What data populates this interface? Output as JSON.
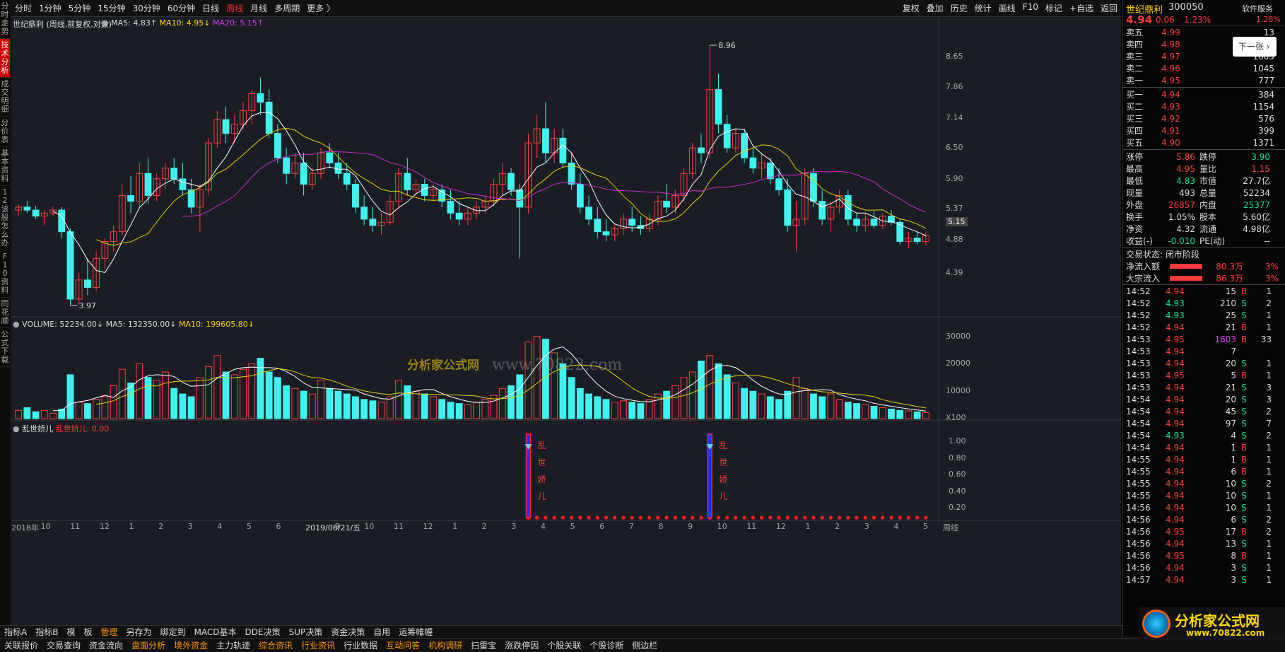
{
  "vtabs": [
    "分时走势",
    "技术分析",
    "成交明细",
    "分价表",
    "基本资料",
    "12该股怎么办",
    "F10资料",
    "同花顺",
    "公式下载"
  ],
  "topbar": {
    "periods": [
      "分时",
      "1分钟",
      "5分钟",
      "15分钟",
      "30分钟",
      "60分钟",
      "日线",
      "周线",
      "月线",
      "多周期",
      "更多 〉"
    ],
    "active": "周线",
    "right": [
      "复权",
      "叠加",
      "历史",
      "统计",
      "画线",
      "F10",
      "标记",
      "+自选",
      "返回"
    ]
  },
  "legend": {
    "title": "世纪鼎利 (周线,前复权,对数)",
    "ma5": "MA5: 4.83↑",
    "ma10": "MA10: 4.95↓",
    "ma20": "MA20: 5.15↑"
  },
  "volume_legend": {
    "vol": "VOLUME: 52234.00↓",
    "ma5": "MA5: 132350.00↓",
    "ma10": "MA10: 199605.80↓"
  },
  "indicator_legend": {
    "name": "乱世娇儿",
    "value": "乱世娇儿: 0.00",
    "signal_text": [
      "乱",
      "世",
      "娇",
      "儿"
    ]
  },
  "price_axis": [
    "8.65",
    "7.86",
    "7.14",
    "6.50",
    "5.90",
    "5.37",
    "5.15",
    "4.88",
    "4.39"
  ],
  "price_marks": {
    "high": "8.96",
    "low": "3.97"
  },
  "volume_axis": [
    "30000",
    "20000",
    "10000",
    "X100"
  ],
  "ind_axis": [
    "1.00",
    "0.80",
    "0.60",
    "0.40",
    "0.20"
  ],
  "time_axis": [
    "2018年",
    "10",
    "11",
    "12",
    "1",
    "2",
    "3",
    "4",
    "5",
    "6",
    "2019/06/21/五",
    "9",
    "10",
    "11",
    "12",
    "1",
    "2",
    "3",
    "4",
    "5",
    "6",
    "7",
    "8",
    "9",
    "10",
    "11",
    "12",
    "1",
    "2",
    "3",
    "4",
    "5",
    "周线"
  ],
  "watermark": {
    "site": "分析家公式网",
    "url": "www.70822.com"
  },
  "bottom_tabs": [
    "指标A",
    "指标B",
    "模",
    "板",
    "管理",
    "另存为",
    "绑定到",
    "MACD基本",
    "DDE决策",
    "SUP决策",
    "资金决策",
    "自用",
    "运筹帷幄"
  ],
  "status_bar": [
    "关联报价",
    "交易查询",
    "资金流向",
    "盘面分析",
    "境外资金",
    "主力轨迹",
    "综合资讯",
    "行业资讯",
    "行业数据",
    "互动问答",
    "机构调研",
    "扫雷宝",
    "涨跌停因",
    "个股关联",
    "个股诊断",
    "侧边栏"
  ],
  "quote": {
    "name": "世纪鼎利",
    "code": "300050",
    "service": "软件服务",
    "price": "4.94",
    "change": "0.06",
    "pct": "1.23%",
    "pct2": "1.28%",
    "next_btn": "下一张",
    "asks": [
      [
        "卖五",
        "4.99",
        "13"
      ],
      [
        "卖四",
        "4.98",
        "13"
      ],
      [
        "卖三",
        "4.97",
        "1005"
      ],
      [
        "卖二",
        "4.96",
        "1045"
      ],
      [
        "卖一",
        "4.95",
        "777"
      ]
    ],
    "bids": [
      [
        "买一",
        "4.94",
        "384"
      ],
      [
        "买二",
        "4.93",
        "1154"
      ],
      [
        "买三",
        "4.92",
        "576"
      ],
      [
        "买四",
        "4.91",
        "399"
      ],
      [
        "买五",
        "4.90",
        "1371"
      ]
    ],
    "stats": [
      [
        "涨停",
        "5.86",
        "跌停",
        "3.90"
      ],
      [
        "最高",
        "4.95",
        "量比",
        "1.15"
      ],
      [
        "最低",
        "4.83",
        "市值",
        "27.7亿"
      ],
      [
        "现量",
        "493",
        "总量",
        "52234"
      ],
      [
        "外盘",
        "26857",
        "内盘",
        "25377"
      ],
      [
        "换手",
        "1.05%",
        "股本",
        "5.60亿"
      ],
      [
        "净资",
        "4.32",
        "流通",
        "4.98亿"
      ],
      [
        "收益(-)",
        "-0.010",
        "PE(动)",
        "--"
      ]
    ],
    "status": "交易状态: 闭市阶段",
    "flows": [
      [
        "净流入额",
        "80.3万",
        "3%"
      ],
      [
        "大宗流入",
        "86.3万",
        "3%"
      ]
    ],
    "ticks": [
      [
        "14:52",
        "4.94",
        "15",
        "B",
        "1"
      ],
      [
        "14:52",
        "4.93",
        "210",
        "S",
        "2"
      ],
      [
        "14:52",
        "4.93",
        "25",
        "S",
        "1"
      ],
      [
        "14:52",
        "4.94",
        "21",
        "B",
        "1"
      ],
      [
        "14:53",
        "4.95",
        "1603",
        "B",
        "33"
      ],
      [
        "14:53",
        "4.94",
        "7",
        "",
        ""
      ],
      [
        "14:53",
        "4.94",
        "20",
        "S",
        "1"
      ],
      [
        "14:53",
        "4.95",
        "5",
        "B",
        "1"
      ],
      [
        "14:53",
        "4.94",
        "21",
        "S",
        "3"
      ],
      [
        "14:54",
        "4.94",
        "20",
        "S",
        "3"
      ],
      [
        "14:54",
        "4.94",
        "45",
        "S",
        "2"
      ],
      [
        "14:54",
        "4.94",
        "97",
        "S",
        "7"
      ],
      [
        "14:54",
        "4.93",
        "4",
        "S",
        "2"
      ],
      [
        "14:54",
        "4.94",
        "1",
        "B",
        "1"
      ],
      [
        "14:55",
        "4.94",
        "1",
        "B",
        "1"
      ],
      [
        "14:55",
        "4.94",
        "6",
        "B",
        "1"
      ],
      [
        "14:55",
        "4.94",
        "10",
        "S",
        "2"
      ],
      [
        "14:55",
        "4.94",
        "10",
        "S",
        "1"
      ],
      [
        "14:56",
        "4.94",
        "10",
        "S",
        "1"
      ],
      [
        "14:56",
        "4.94",
        "6",
        "S",
        "2"
      ],
      [
        "14:56",
        "4.95",
        "17",
        "B",
        "2"
      ],
      [
        "14:56",
        "4.94",
        "13",
        "S",
        "1"
      ],
      [
        "14:56",
        "4.95",
        "8",
        "B",
        "1"
      ],
      [
        "14:56",
        "4.94",
        "3",
        "S",
        "1"
      ],
      [
        "14:57",
        "4.94",
        "3",
        "S",
        "1"
      ]
    ]
  },
  "chart_data": {
    "type": "candlestick",
    "price_ohlc": [
      [
        5.35,
        5.45,
        5.25,
        5.4
      ],
      [
        5.4,
        5.5,
        5.3,
        5.35
      ],
      [
        5.35,
        5.42,
        5.2,
        5.25
      ],
      [
        5.25,
        5.35,
        5.1,
        5.3
      ],
      [
        5.3,
        5.4,
        5.25,
        5.35
      ],
      [
        5.35,
        5.4,
        4.9,
        5.0
      ],
      [
        5.0,
        5.05,
        3.97,
        4.05
      ],
      [
        4.05,
        4.4,
        3.98,
        4.3
      ],
      [
        4.3,
        4.6,
        4.1,
        4.2
      ],
      [
        4.2,
        4.7,
        4.15,
        4.6
      ],
      [
        4.6,
        4.9,
        4.45,
        4.85
      ],
      [
        4.85,
        5.1,
        4.7,
        5.0
      ],
      [
        5.0,
        5.8,
        4.95,
        5.6
      ],
      [
        5.6,
        5.95,
        5.3,
        5.5
      ],
      [
        5.5,
        6.2,
        5.4,
        6.0
      ],
      [
        6.0,
        6.3,
        5.45,
        5.6
      ],
      [
        5.6,
        6.0,
        5.5,
        5.9
      ],
      [
        5.9,
        6.2,
        5.7,
        6.1
      ],
      [
        6.1,
        6.3,
        5.8,
        5.9
      ],
      [
        5.9,
        6.2,
        5.6,
        5.7
      ],
      [
        5.7,
        5.9,
        5.3,
        5.4
      ],
      [
        5.4,
        5.8,
        5.0,
        5.7
      ],
      [
        5.7,
        6.7,
        5.6,
        6.6
      ],
      [
        6.6,
        7.3,
        6.5,
        7.1
      ],
      [
        7.1,
        7.4,
        6.6,
        6.8
      ],
      [
        6.8,
        7.2,
        6.6,
        7.0
      ],
      [
        7.0,
        7.5,
        6.9,
        7.3
      ],
      [
        7.3,
        7.8,
        7.0,
        7.7
      ],
      [
        7.7,
        8.1,
        7.2,
        7.5
      ],
      [
        7.5,
        7.8,
        6.7,
        6.8
      ],
      [
        6.8,
        7.0,
        6.2,
        6.3
      ],
      [
        6.3,
        6.5,
        5.8,
        6.0
      ],
      [
        6.0,
        6.4,
        5.9,
        6.2
      ],
      [
        6.2,
        6.4,
        5.6,
        5.8
      ],
      [
        5.8,
        6.1,
        5.7,
        6.0
      ],
      [
        6.0,
        6.5,
        5.9,
        6.4
      ],
      [
        6.4,
        6.6,
        6.1,
        6.2
      ],
      [
        6.2,
        6.4,
        5.9,
        6.0
      ],
      [
        6.0,
        6.2,
        5.7,
        5.8
      ],
      [
        5.8,
        5.9,
        5.3,
        5.4
      ],
      [
        5.4,
        5.6,
        5.1,
        5.2
      ],
      [
        5.2,
        5.4,
        5.0,
        5.1
      ],
      [
        5.1,
        5.3,
        4.95,
        5.15
      ],
      [
        5.15,
        5.6,
        5.1,
        5.5
      ],
      [
        5.5,
        6.1,
        5.4,
        6.0
      ],
      [
        6.0,
        6.3,
        5.6,
        5.7
      ],
      [
        5.7,
        5.9,
        5.6,
        5.8
      ],
      [
        5.8,
        5.9,
        5.5,
        5.6
      ],
      [
        5.6,
        5.8,
        5.5,
        5.7
      ],
      [
        5.7,
        5.8,
        5.4,
        5.5
      ],
      [
        5.5,
        5.7,
        5.2,
        5.3
      ],
      [
        5.3,
        5.5,
        5.1,
        5.2
      ],
      [
        5.2,
        5.4,
        5.1,
        5.3
      ],
      [
        5.3,
        5.5,
        5.2,
        5.4
      ],
      [
        5.4,
        5.6,
        5.3,
        5.5
      ],
      [
        5.5,
        5.9,
        5.4,
        5.8
      ],
      [
        5.8,
        6.2,
        5.6,
        6.0
      ],
      [
        6.0,
        6.1,
        5.6,
        5.7
      ],
      [
        5.7,
        5.8,
        4.6,
        5.4
      ],
      [
        5.4,
        6.8,
        5.3,
        6.6
      ],
      [
        6.6,
        7.2,
        6.3,
        6.9
      ],
      [
        6.9,
        7.5,
        6.2,
        6.4
      ],
      [
        6.4,
        6.9,
        6.2,
        6.7
      ],
      [
        6.7,
        6.9,
        6.1,
        6.2
      ],
      [
        6.2,
        6.4,
        5.7,
        5.8
      ],
      [
        5.8,
        6.0,
        5.3,
        5.4
      ],
      [
        5.4,
        5.6,
        5.1,
        5.2
      ],
      [
        5.2,
        5.4,
        4.9,
        5.0
      ],
      [
        5.0,
        5.2,
        4.85,
        4.95
      ],
      [
        4.95,
        5.1,
        4.85,
        5.05
      ],
      [
        5.05,
        5.3,
        4.95,
        5.2
      ],
      [
        5.2,
        5.4,
        5.0,
        5.1
      ],
      [
        5.1,
        5.25,
        4.95,
        5.05
      ],
      [
        5.05,
        5.3,
        5.0,
        5.2
      ],
      [
        5.2,
        5.6,
        5.1,
        5.5
      ],
      [
        5.5,
        5.8,
        5.3,
        5.4
      ],
      [
        5.4,
        5.7,
        5.3,
        5.6
      ],
      [
        5.6,
        6.1,
        5.5,
        6.0
      ],
      [
        6.0,
        6.6,
        5.9,
        6.5
      ],
      [
        6.5,
        6.8,
        6.2,
        6.4
      ],
      [
        6.4,
        8.96,
        6.3,
        7.8
      ],
      [
        7.8,
        8.2,
        6.8,
        7.0
      ],
      [
        7.0,
        7.2,
        6.4,
        6.5
      ],
      [
        6.5,
        6.9,
        6.4,
        6.8
      ],
      [
        6.8,
        6.9,
        6.2,
        6.3
      ],
      [
        6.3,
        6.5,
        6.0,
        6.1
      ],
      [
        6.1,
        6.4,
        5.9,
        6.2
      ],
      [
        6.2,
        6.3,
        5.8,
        5.9
      ],
      [
        5.9,
        6.1,
        5.6,
        5.7
      ],
      [
        5.7,
        5.9,
        5.0,
        5.1
      ],
      [
        5.1,
        5.5,
        4.7,
        5.2
      ],
      [
        5.2,
        6.1,
        5.1,
        6.0
      ],
      [
        6.0,
        6.1,
        5.4,
        5.5
      ],
      [
        5.5,
        5.7,
        5.1,
        5.2
      ],
      [
        5.2,
        5.5,
        5.0,
        5.4
      ],
      [
        5.4,
        5.7,
        5.3,
        5.6
      ],
      [
        5.6,
        5.7,
        5.1,
        5.2
      ],
      [
        5.2,
        5.3,
        5.0,
        5.1
      ],
      [
        5.1,
        5.3,
        5.0,
        5.2
      ],
      [
        5.2,
        5.35,
        5.05,
        5.1
      ],
      [
        5.1,
        5.3,
        5.05,
        5.25
      ],
      [
        5.25,
        5.35,
        5.1,
        5.15
      ],
      [
        5.15,
        5.2,
        4.8,
        4.85
      ],
      [
        4.85,
        5.0,
        4.75,
        4.9
      ],
      [
        4.9,
        5.0,
        4.8,
        4.85
      ],
      [
        4.85,
        5.0,
        4.8,
        4.94
      ]
    ],
    "volume": [
      30,
      40,
      25,
      30,
      20,
      35,
      160,
      60,
      55,
      70,
      80,
      120,
      180,
      130,
      200,
      150,
      140,
      170,
      110,
      90,
      80,
      150,
      190,
      230,
      170,
      160,
      180,
      200,
      220,
      170,
      150,
      120,
      110,
      100,
      90,
      140,
      110,
      100,
      90,
      80,
      70,
      65,
      60,
      80,
      140,
      120,
      100,
      90,
      80,
      70,
      60,
      55,
      50,
      60,
      70,
      85,
      110,
      120,
      160,
      280,
      300,
      290,
      240,
      200,
      150,
      110,
      90,
      80,
      70,
      60,
      65,
      60,
      55,
      70,
      90,
      100,
      120,
      150,
      170,
      210,
      230,
      200,
      160,
      130,
      110,
      100,
      90,
      80,
      70,
      100,
      150,
      110,
      90,
      80,
      90,
      70,
      60,
      55,
      50,
      45,
      40,
      35,
      30,
      28,
      25,
      22
    ],
    "signals": [
      59,
      80
    ],
    "price_range": [
      3.9,
      9.2
    ],
    "volume_max": 330
  }
}
